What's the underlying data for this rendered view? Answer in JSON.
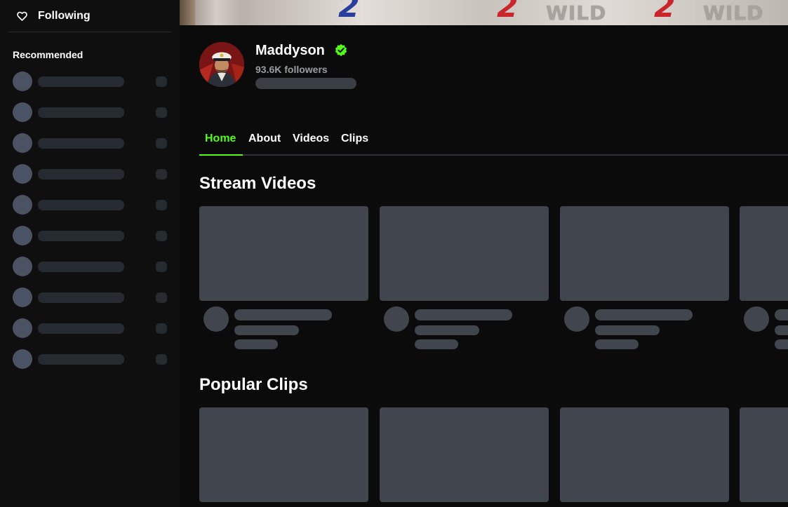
{
  "sidebar": {
    "following_label": "Following",
    "recommended_title": "Recommended"
  },
  "channel": {
    "name": "Maddyson",
    "followers": "93.6K followers",
    "verified": true
  },
  "banner": {
    "glyphs": [
      "2",
      "2",
      "2"
    ],
    "words": [
      "WILD",
      "WILD"
    ]
  },
  "tabs": [
    {
      "label": "Home",
      "active": true
    },
    {
      "label": "About",
      "active": false
    },
    {
      "label": "Videos",
      "active": false
    },
    {
      "label": "Clips",
      "active": false
    }
  ],
  "sections": {
    "stream_videos_title": "Stream Videos",
    "popular_clips_title": "Popular Clips"
  },
  "colors": {
    "accent": "#53fc18",
    "background": "#0b0b0c",
    "sidebar": "#0f0f10",
    "skeleton": "#41454d",
    "banner_glyph_red": "#c8262c",
    "banner_glyph_blue": "#2a3f9c"
  },
  "icons": {
    "following": "heart-outline-icon",
    "verified": "verified-badge-icon"
  }
}
